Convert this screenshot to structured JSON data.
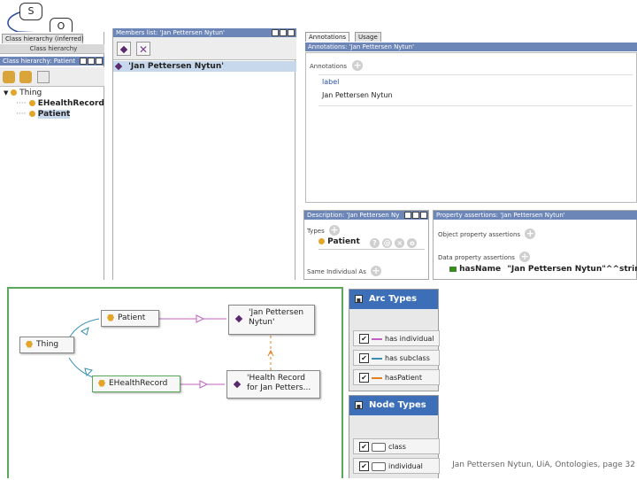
{
  "callouts": {
    "s_label": "S",
    "o_label": "O"
  },
  "class_tabs": {
    "inferred": "Class hierarchy (inferred)",
    "asserted": "Class hierarchy"
  },
  "class_panel": {
    "title": "Class hierarchy: Patient",
    "tree": [
      {
        "label": "Thing"
      },
      {
        "label": "EHealthRecord"
      },
      {
        "label": "Patient"
      }
    ]
  },
  "members_panel": {
    "title": "Members list: 'Jan Pettersen Nytun'",
    "items": [
      {
        "label": "'Jan Pettersen Nytun'"
      }
    ]
  },
  "annotations_panel": {
    "tabs": [
      "Annotations",
      "Usage"
    ],
    "title": "Annotations: 'Jan Pettersen Nytun'",
    "section_label": "Annotations",
    "annotation_property": "label",
    "annotation_value": "Jan Pettersen Nytun"
  },
  "description_panel": {
    "title": "Description: 'Jan Pettersen Ny",
    "types_label": "Types",
    "type_value": "Patient",
    "same_label": "Same Individual As"
  },
  "property_panel": {
    "title": "Property assertions: 'Jan Pettersen Nytun'",
    "object_label": "Object property assertions",
    "data_label": "Data property assertions",
    "data_property": "hasName",
    "data_value": "\"Jan Pettersen Nytun\"^^string"
  },
  "graph": {
    "nodes": {
      "thing": "Thing",
      "patient": "Patient",
      "ehealth": "EHealthRecord",
      "jan": [
        "'Jan Pettersen",
        "Nytun'"
      ],
      "record": [
        "'Health Record",
        "for Jan Petters..."
      ]
    }
  },
  "arc_types": {
    "title": "Arc Types",
    "items": [
      {
        "label": "has individual",
        "color": "#c060c0"
      },
      {
        "label": "has subclass",
        "color": "#3a8fb0"
      },
      {
        "label": "hasPatient",
        "color": "#e08020"
      }
    ]
  },
  "node_types": {
    "title": "Node Types",
    "items": [
      {
        "label": "class"
      },
      {
        "label": "individual"
      }
    ]
  },
  "footer": "Jan Pettersen Nytun, UiA, Ontologies, page 32"
}
